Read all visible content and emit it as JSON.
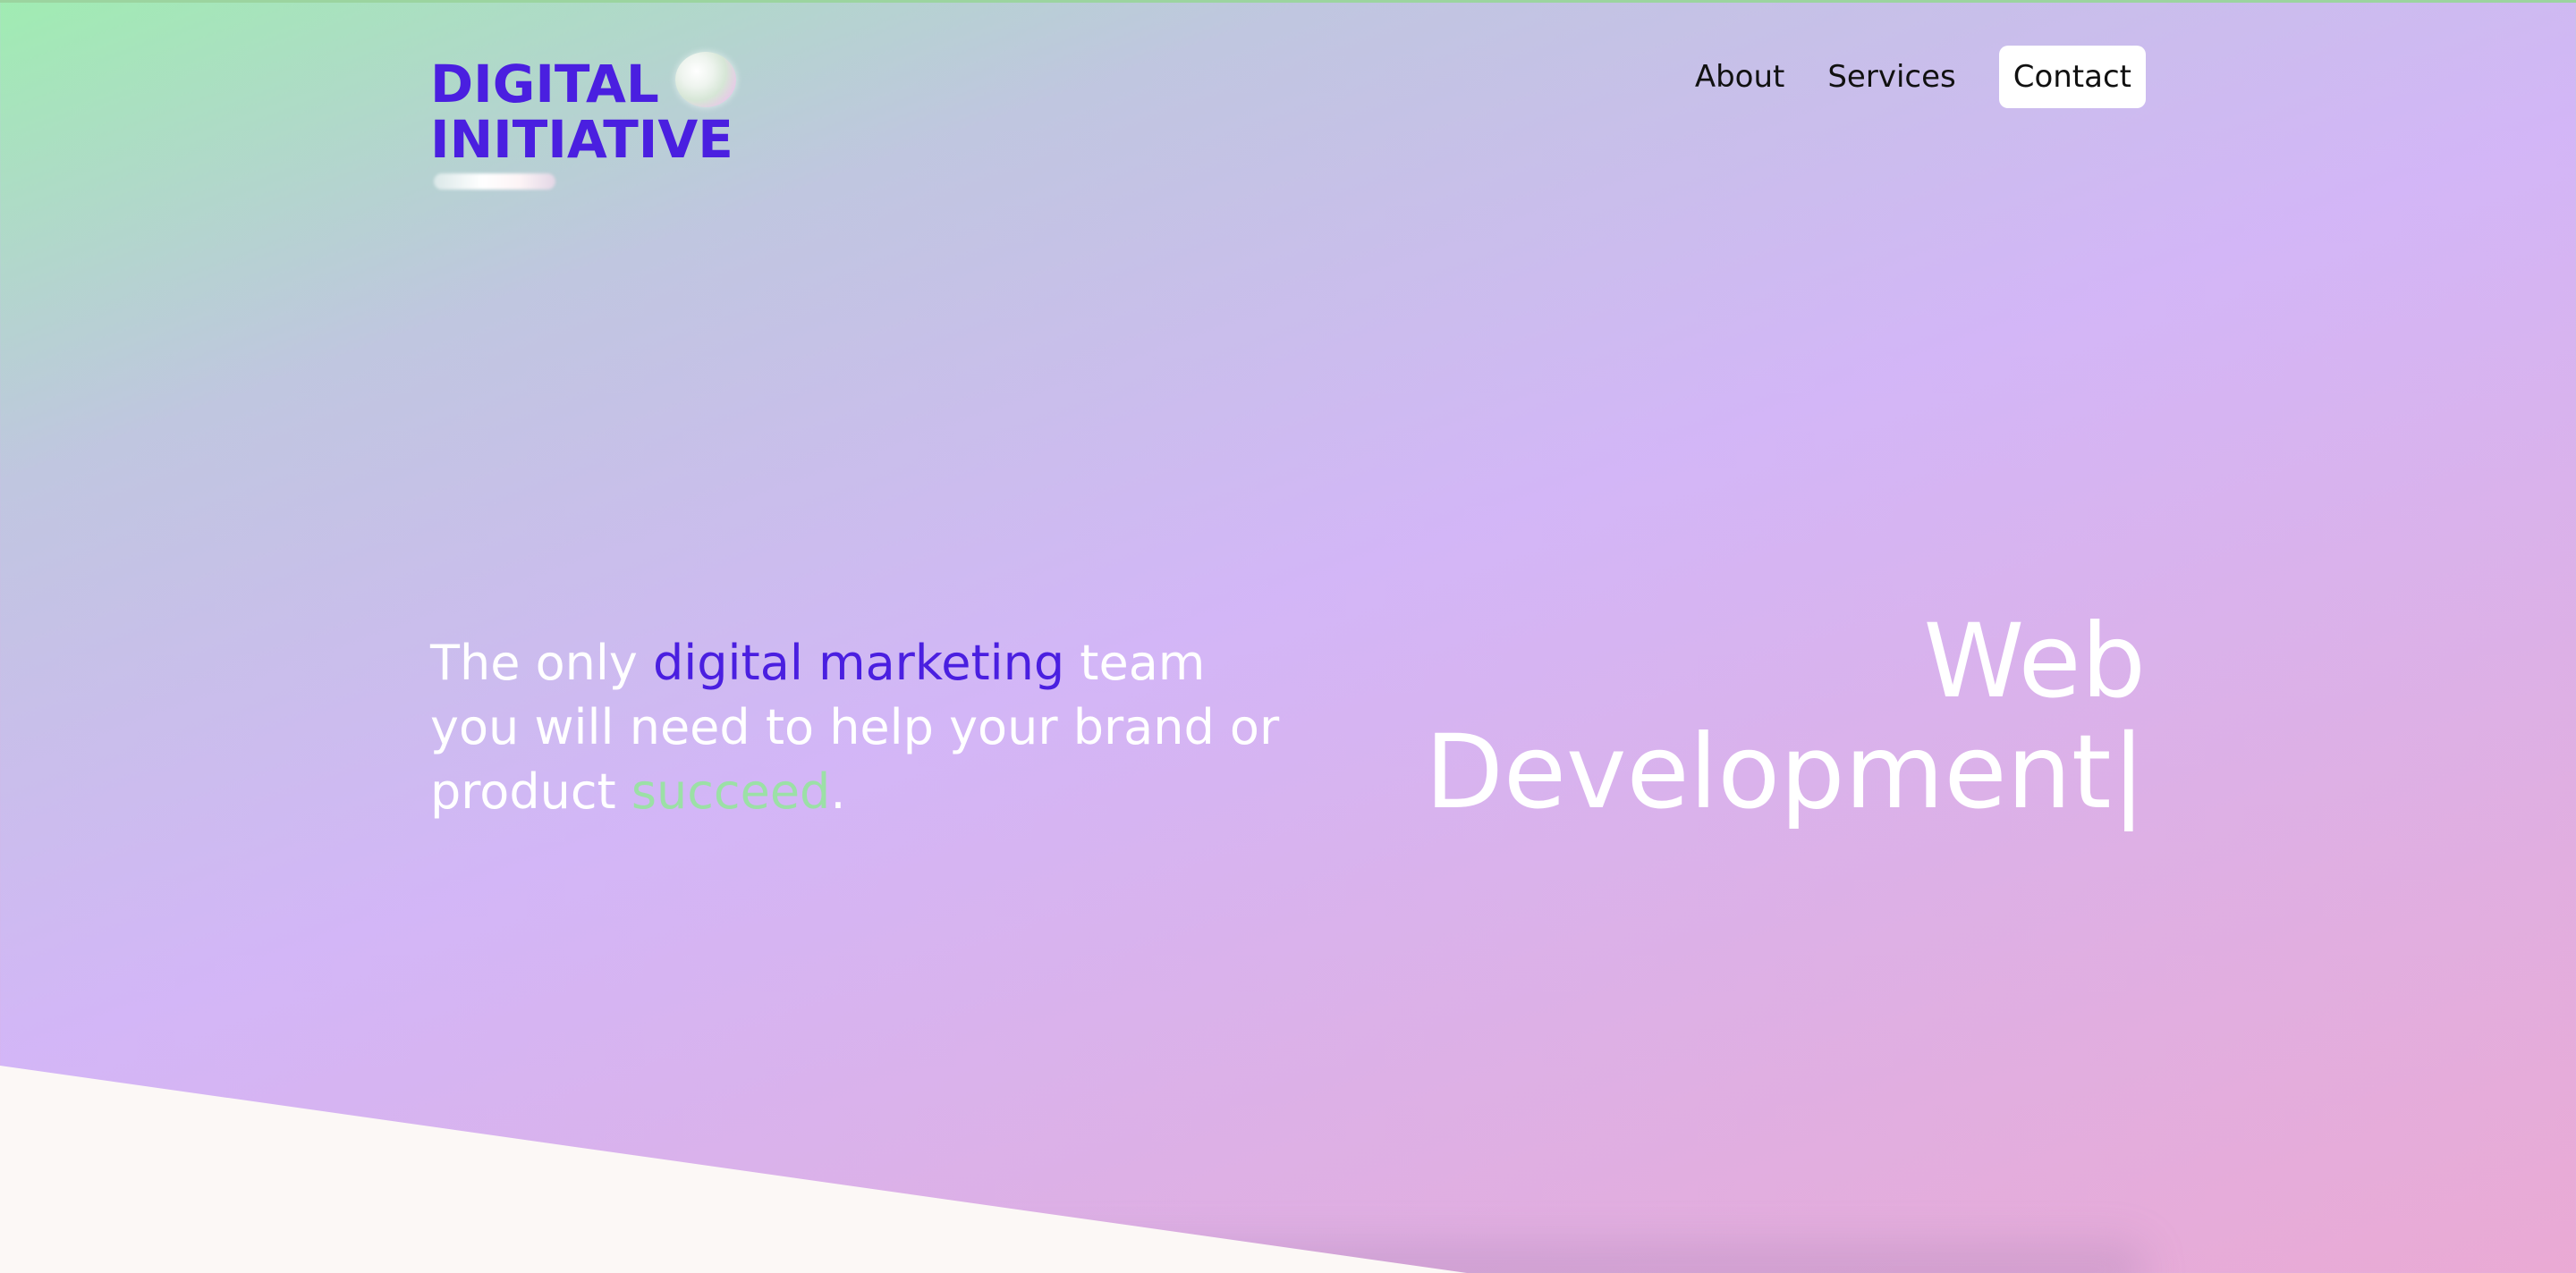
{
  "logo": {
    "line1": "DIGITAL",
    "line2": "INITIATIVE"
  },
  "nav": {
    "about": "About",
    "services": "Services",
    "contact": "Contact"
  },
  "hero": {
    "part1": "The only ",
    "highlight_purple": "digital marketing",
    "part2": " team you will need to help your brand or product ",
    "highlight_green": "succeed",
    "part3": "."
  },
  "rotator": {
    "line1": "Web",
    "line2": "Development",
    "cursor": "|"
  },
  "colors": {
    "brand_purple": "#4a1fe0",
    "accent_green": "#9be0a6",
    "bottom_section": "#fcf8f6"
  }
}
